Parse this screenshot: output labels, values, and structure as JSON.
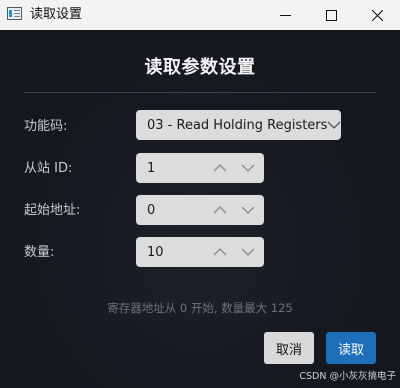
{
  "window": {
    "title": "读取设置"
  },
  "dialog": {
    "heading": "读取参数设置",
    "function_code": {
      "label": "功能码:",
      "selected": "03 - Read Holding Registers"
    },
    "slave_id": {
      "label": "从站 ID:",
      "value": "1"
    },
    "start_address": {
      "label": "起始地址:",
      "value": "0"
    },
    "quantity": {
      "label": "数量:",
      "value": "10"
    },
    "hint": "寄存器地址从 0 开始, 数量最大 125",
    "cancel_label": "取消",
    "read_label": "读取"
  },
  "watermark": "CSDN @小灰灰搞电子",
  "colors": {
    "accent": "#1f6fb8",
    "background": "#15181d",
    "field": "#dcdcdc"
  }
}
